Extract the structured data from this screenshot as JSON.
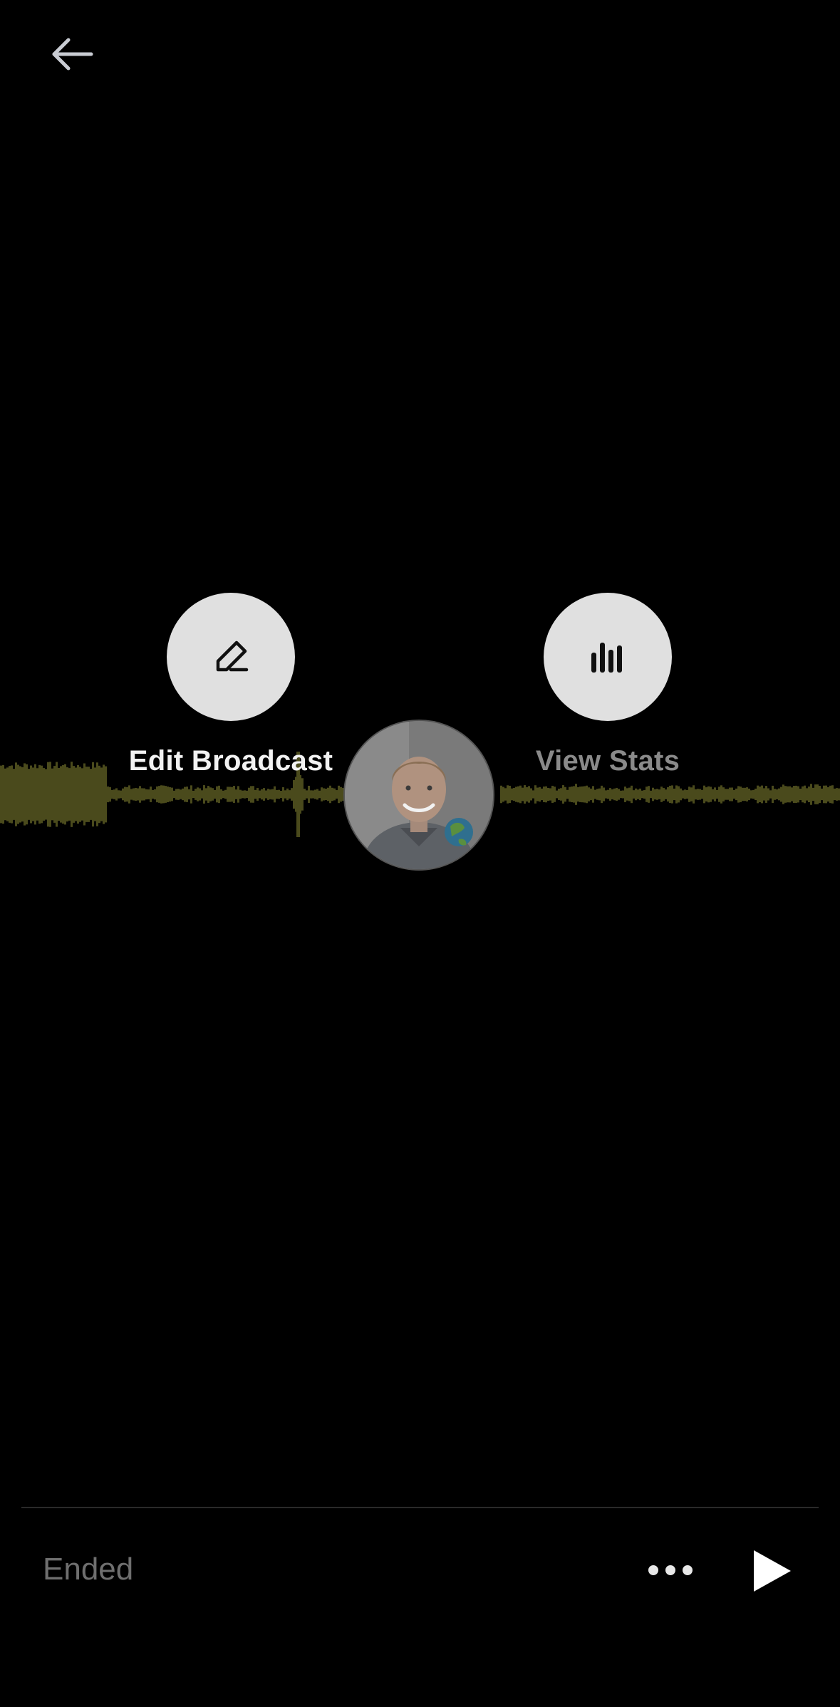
{
  "header": {
    "back_icon": "arrow-left-icon"
  },
  "actions": {
    "edit": {
      "label": "Edit Broadcast",
      "icon": "pencil-icon"
    },
    "stats": {
      "label": "View Stats",
      "icon": "bar-chart-icon"
    }
  },
  "player": {
    "status": "Ended",
    "more_icon": "more-horizontal-icon",
    "play_icon": "play-icon",
    "waveform_color": "#4a4a1c"
  },
  "host": {
    "avatar": "host-avatar"
  }
}
